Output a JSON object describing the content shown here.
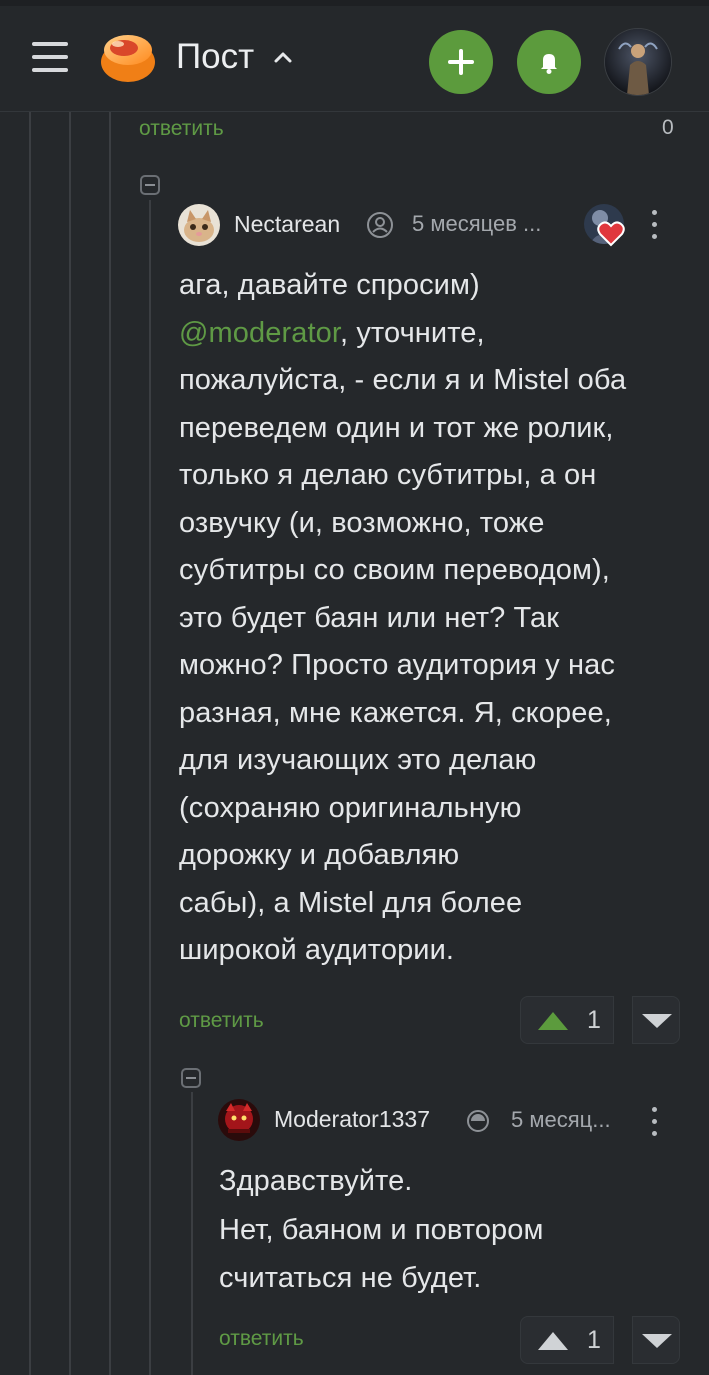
{
  "header": {
    "title": "Пост",
    "colors": {
      "accent": "#5c9b3d",
      "background": "#25282b"
    },
    "icons": [
      "menu-icon",
      "logo",
      "chevron-up-icon",
      "plus-icon",
      "bell-icon",
      "avatar"
    ]
  },
  "top_reply": {
    "reply_label": "ответить",
    "count": "0"
  },
  "comments": [
    {
      "username": "Nectarean",
      "time": "5 месяцев ...",
      "body_lines": [
        "ага, давайте спросим)",
        "@moderator, уточните,",
        "пожалуйста, - если я и Mistel оба",
        "переведем один и тот же ролик,",
        "только я делаю субтитры, а он",
        "озвучку (и, возможно, тоже",
        "субтитры со своим переводом),",
        "это будет баян или нет? Так",
        "можно? Просто аудитория у нас",
        "разная, мне кажется. Я, скорее,",
        "для изучающих это делаю",
        "(сохраняю оригинальную",
        "дорожку и добавляю",
        "сабы), а Mistel для более",
        "широкой аудитории."
      ],
      "mention": "@moderator",
      "mention_rest": ", уточните,",
      "reply_label": "ответить",
      "votes": "1"
    },
    {
      "username": "Moderator1337",
      "time": "5 месяц...",
      "body_lines": [
        "Здравствуйте.",
        "Нет, баяном и повтором",
        "считаться не будет."
      ],
      "reply_label": "ответить",
      "votes": "1"
    }
  ]
}
